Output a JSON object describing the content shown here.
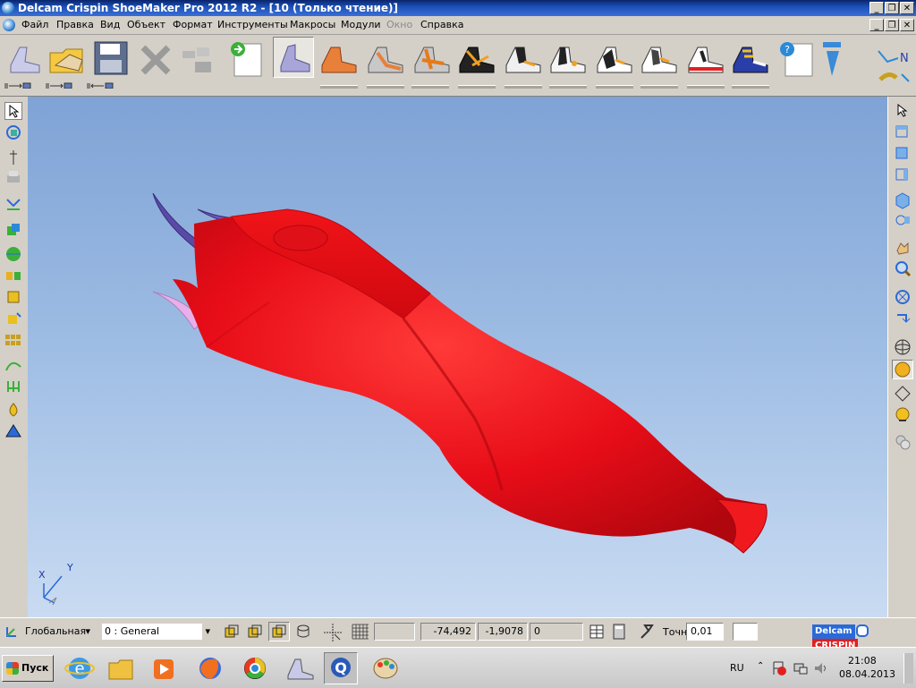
{
  "window": {
    "title": "Delcam Crispin ShoeMaker Pro 2012 R2 - [10 (Только чтение)]",
    "controls": [
      "_",
      "❐",
      "✕"
    ]
  },
  "menu": {
    "items": [
      {
        "label": "Файл"
      },
      {
        "label": "Правка"
      },
      {
        "label": "Вид"
      },
      {
        "label": "Объект"
      },
      {
        "label": "Формат"
      },
      {
        "label": "Инструменты"
      },
      {
        "label": "Макросы"
      },
      {
        "label": "Модули"
      },
      {
        "label": "Окно",
        "disabled": true
      },
      {
        "label": "Справка"
      }
    ]
  },
  "toolbar": {
    "buttons": [
      {
        "name": "new-last",
        "icon": "last-icon"
      },
      {
        "name": "open",
        "icon": "open-folder-icon"
      },
      {
        "name": "save",
        "icon": "floppy-icon"
      },
      {
        "name": "delete",
        "icon": "delete-x-icon"
      },
      {
        "name": "tools",
        "icon": "tools-icon"
      },
      {
        "name": "insert",
        "icon": "insert-icon"
      }
    ],
    "shoe_buttons": [
      "last",
      "bottom",
      "insole",
      "sandal",
      "pump",
      "loafer",
      "oxford",
      "derby",
      "sneaker",
      "sport",
      "boot-colors"
    ],
    "accent": "#e8312a"
  },
  "statusbar": {
    "coord_system": "Глобальная",
    "layer": "0  : General",
    "x_value": "-74,492",
    "y_value": "-1,9078",
    "z_value": "0",
    "tolerance_label": "Точн",
    "tolerance_value": "0,01",
    "brand_left": "Delcam",
    "brand_right": "CRISPIN"
  },
  "axis": {
    "x": "X",
    "y": "Y"
  },
  "model": {
    "color": "#e8101a",
    "description": "shoe last surface"
  },
  "taskbar": {
    "start_label": "Пуск",
    "language": "RU",
    "time": "21:08",
    "date": "08.04.2013",
    "apps": [
      "ie-icon",
      "folder-icon",
      "media-player-icon",
      "firefox-icon",
      "chrome-icon",
      "shoe-app-icon",
      "crispin-icon",
      "paint-icon"
    ]
  }
}
